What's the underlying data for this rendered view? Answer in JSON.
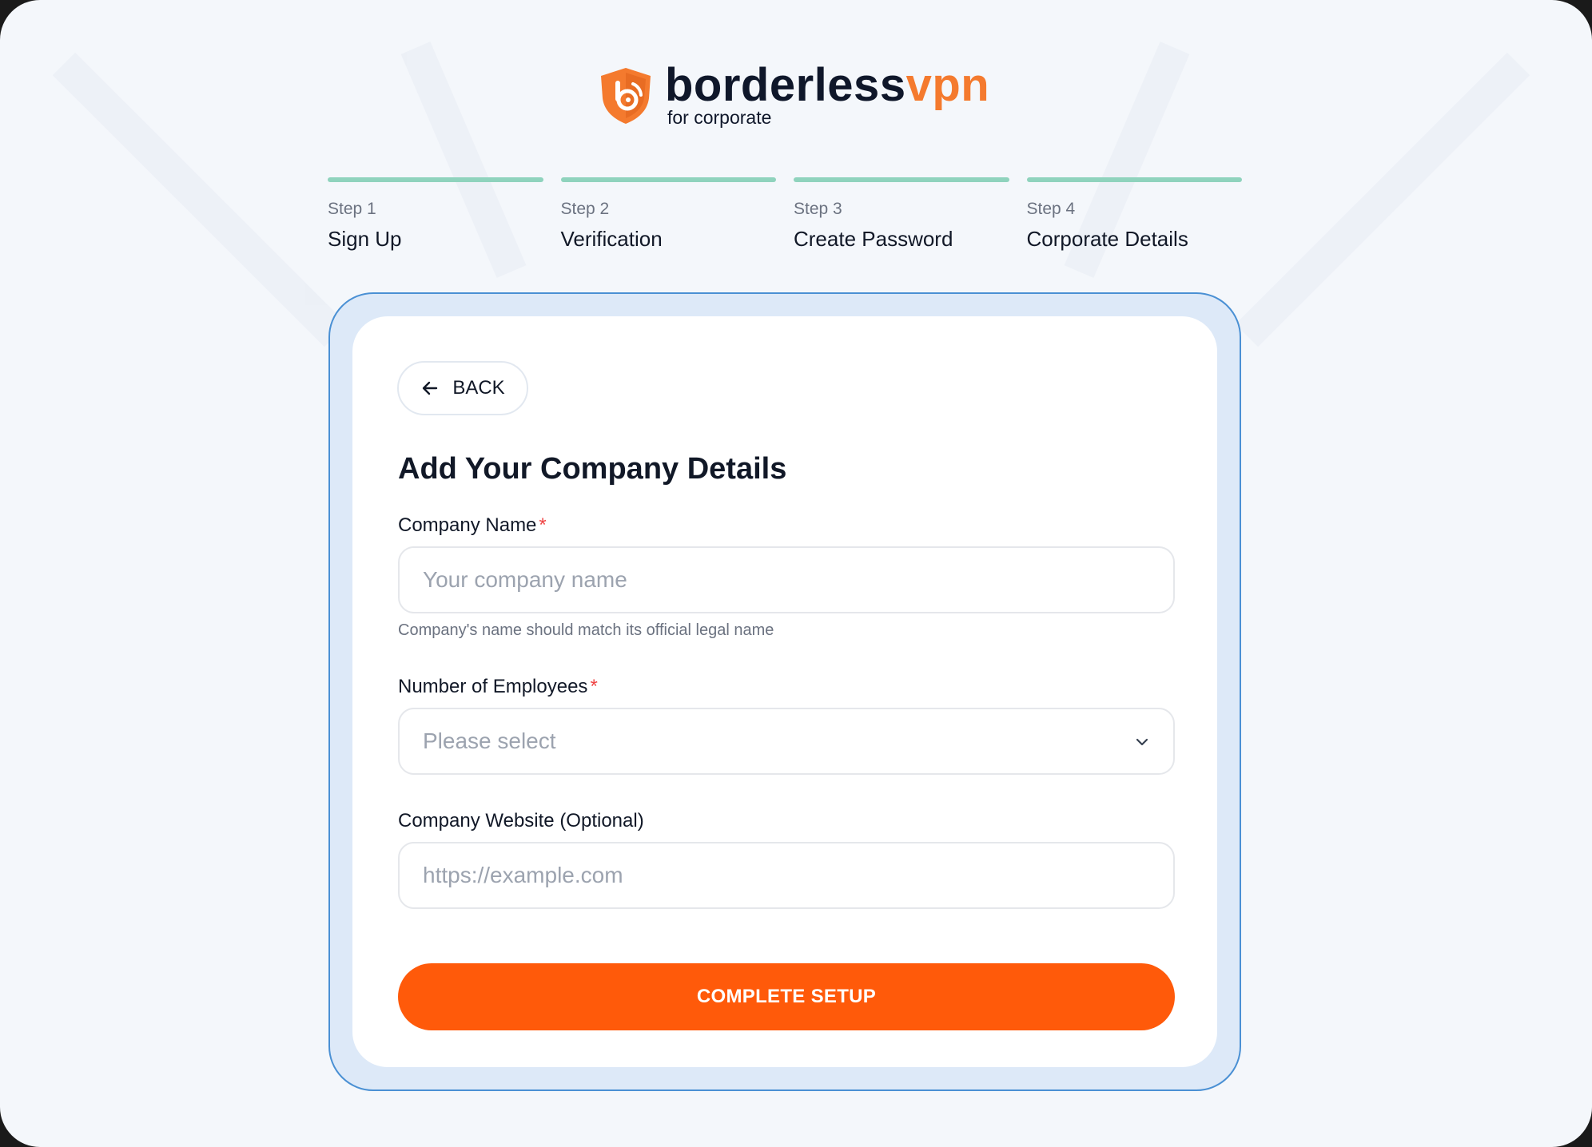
{
  "brand": {
    "name_main": "borderless",
    "name_accent": "vpn",
    "subtitle": "for corporate",
    "accent_color": "#f47a2e",
    "logo_icon": "shield-b-icon"
  },
  "steps": [
    {
      "num": "Step 1",
      "label": "Sign Up"
    },
    {
      "num": "Step 2",
      "label": "Verification"
    },
    {
      "num": "Step 3",
      "label": "Create Password"
    },
    {
      "num": "Step 4",
      "label": "Corporate Details"
    }
  ],
  "form": {
    "back_label": "BACK",
    "title": "Add Your Company Details",
    "company_name": {
      "label": "Company Name",
      "required": "*",
      "placeholder": "Your company name",
      "hint": "Company's name should match its official legal name"
    },
    "employees": {
      "label": "Number of Employees",
      "required": "*",
      "selected": "Please select"
    },
    "website": {
      "label": "Company Website (Optional)",
      "placeholder": "https://example.com"
    },
    "submit_label": "COMPLETE SETUP"
  },
  "colors": {
    "step_bar": "#8fd3bd",
    "submit": "#ff5a0a",
    "card_border": "#4a90d4",
    "card_bg": "#dde9f8"
  }
}
